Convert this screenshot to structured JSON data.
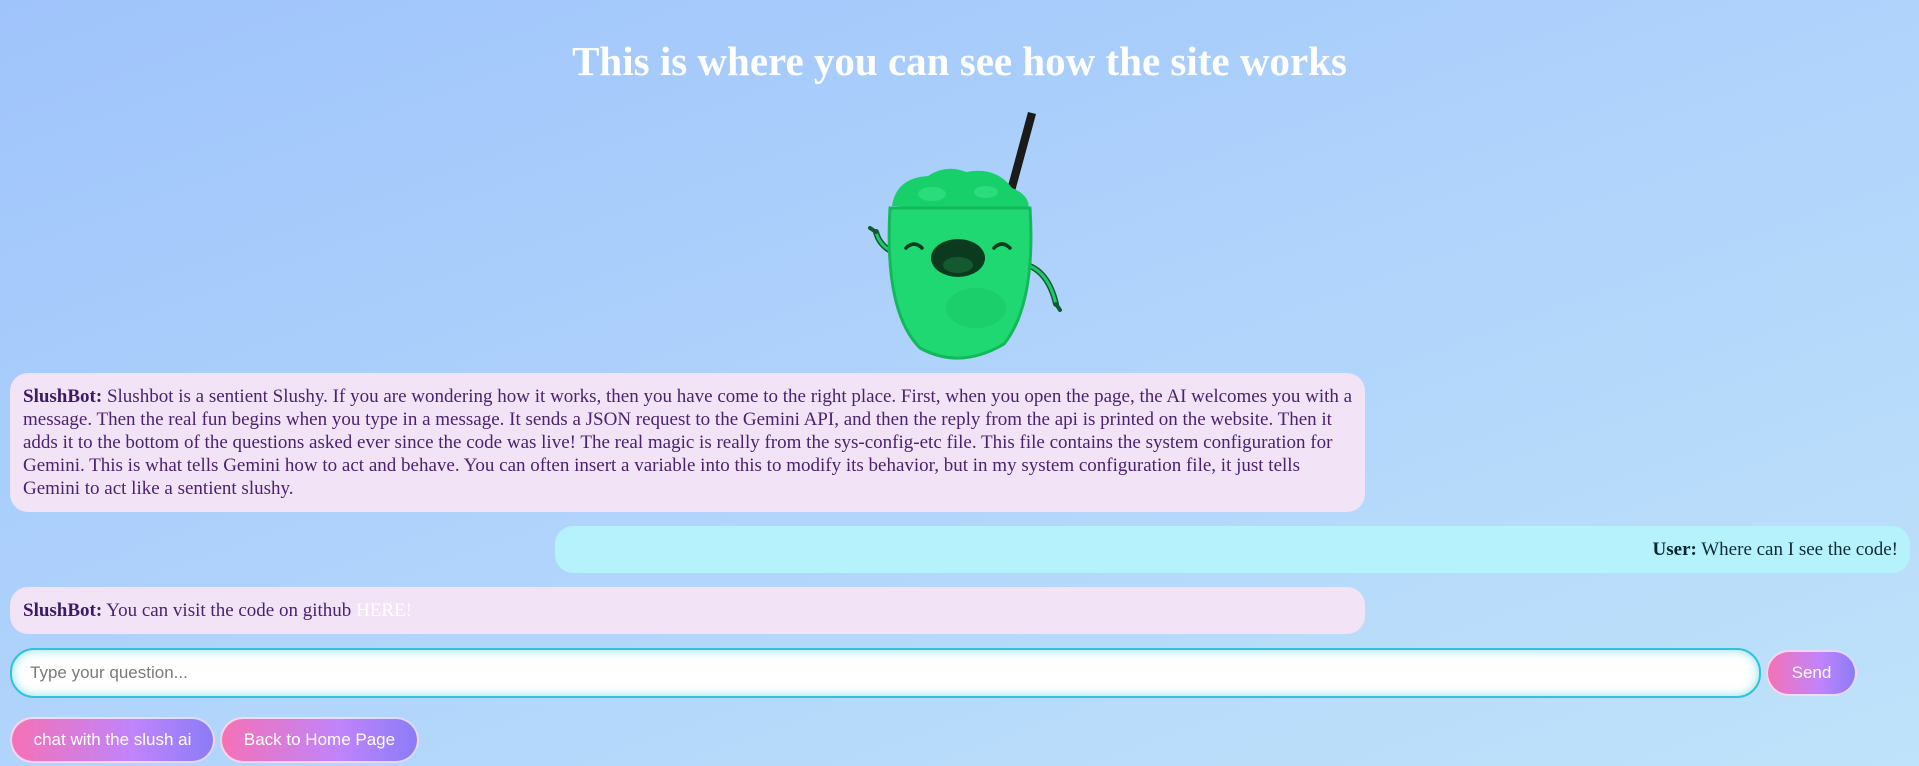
{
  "page": {
    "title": "This is where you can see how the site works"
  },
  "mascot": {
    "icon": "slushy-mascot-icon",
    "colors": {
      "body": "#1fd872",
      "face": "#0c3a1f",
      "straw": "#1a1a1a"
    }
  },
  "messages": [
    {
      "sender": "SlushBot:",
      "text": " Slushbot is a sentient Slushy. If you are wondering how it works, then you have come to the right place. First, when you open the page, the AI welcomes you with a message. Then the real fun begins when you type in a message. It sends a JSON request to the Gemini API, and then the reply from the api is printed on the website. Then it adds it to the bottom of the questions asked ever since the code was live! The real magic is really from the sys-config-etc file. This file contains the system configuration for Gemini. This is what tells Gemini how to act and behave. You can often insert a variable into this to modify its behavior, but in my system configuration file, it just tells Gemini to act like a sentient slushy."
    },
    {
      "sender": "User:",
      "text": " Where can I see the code!"
    },
    {
      "sender": "SlushBot:",
      "text": " You can visit the code on github ",
      "link_text": "HERE!"
    }
  ],
  "input": {
    "placeholder": "Type your question...",
    "value": ""
  },
  "buttons": {
    "send": "Send",
    "chat": "chat with the slush ai",
    "home": "Back to Home Page"
  },
  "colors": {
    "bot_bubble": "#f2e3f6",
    "user_bubble": "#b6f2fb",
    "button_gradient_start": "#f472b6",
    "button_gradient_end": "#8b7cf6",
    "input_border": "#2fc3d9"
  }
}
